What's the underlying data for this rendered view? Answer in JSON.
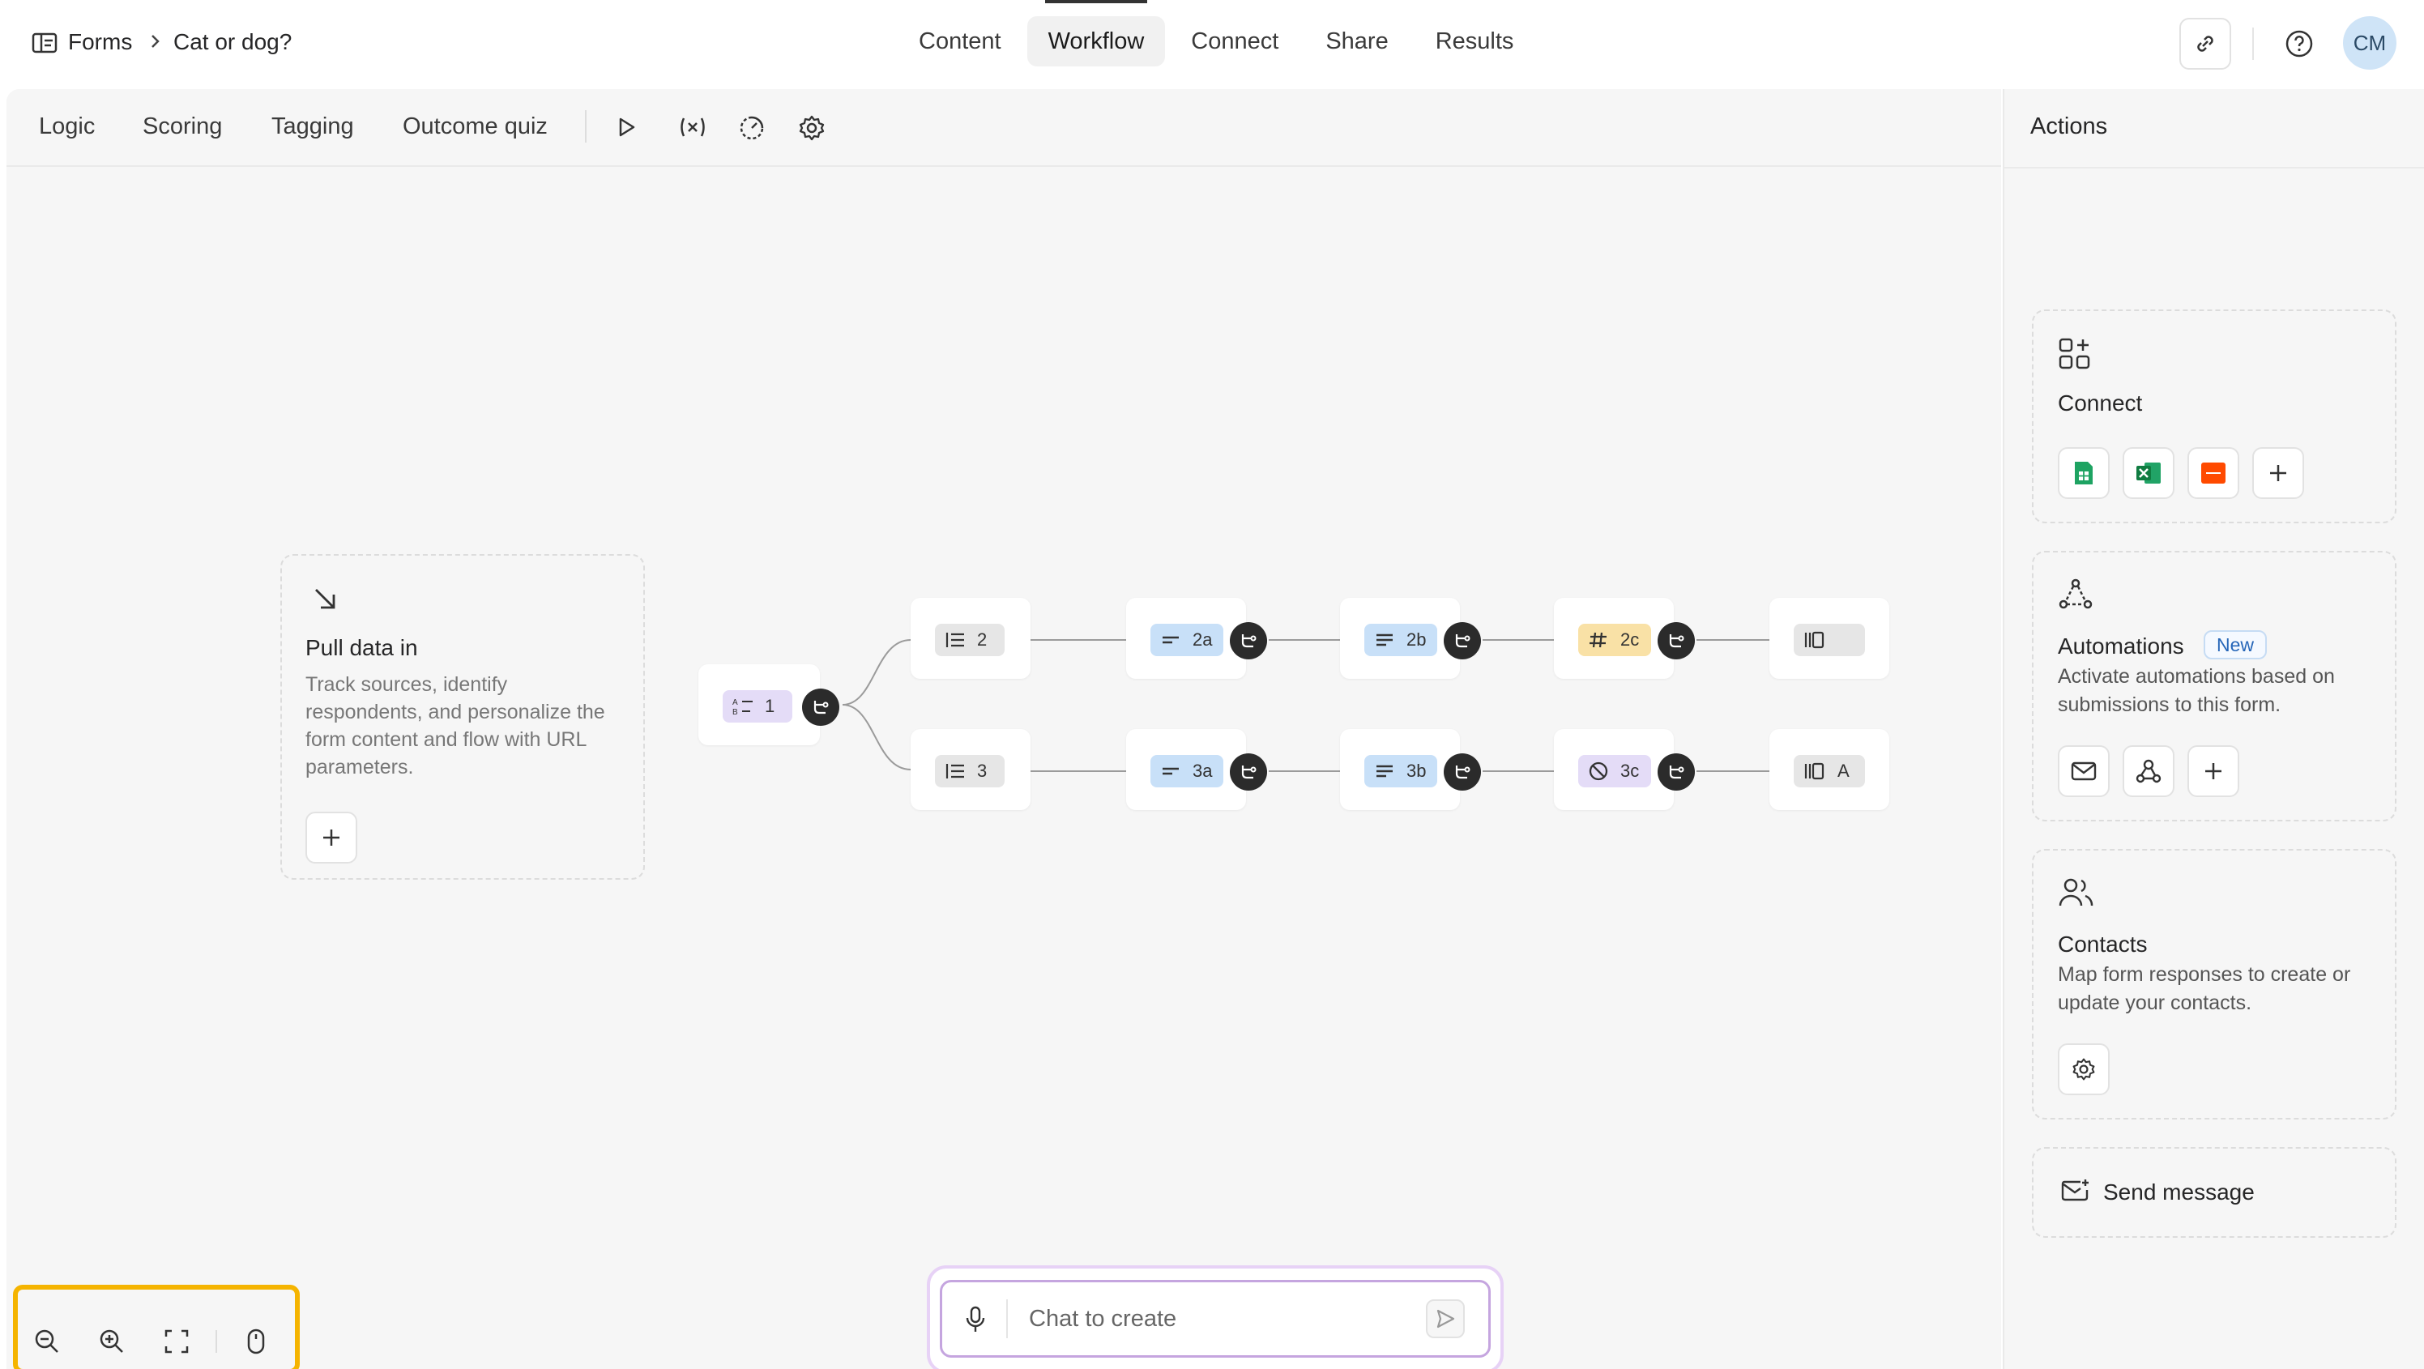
{
  "breadcrumb": {
    "root": "Forms",
    "current": "Cat or dog?"
  },
  "nav": {
    "tabs": [
      "Content",
      "Workflow",
      "Connect",
      "Share",
      "Results"
    ],
    "active": "Workflow"
  },
  "header": {
    "avatar_initials": "CM"
  },
  "toolbar": {
    "tabs": [
      "Logic",
      "Scoring",
      "Tagging",
      "Outcome quiz"
    ]
  },
  "pull_data": {
    "title": "Pull data in",
    "description": "Track sources, identify respondents, and personalize the form content and flow with URL parameters."
  },
  "flow": {
    "start": "1",
    "row1": [
      "2",
      "2a",
      "2b",
      "2c",
      ""
    ],
    "row2": [
      "3",
      "3a",
      "3b",
      "3c",
      "A"
    ]
  },
  "panel": {
    "title": "Actions",
    "connect": {
      "title": "Connect"
    },
    "automations": {
      "title": "Automations",
      "badge": "New",
      "description": "Activate automations based on submissions to this form."
    },
    "contacts": {
      "title": "Contacts",
      "description": "Map form responses to create or update your contacts."
    },
    "send_message": {
      "title": "Send message"
    }
  },
  "chat": {
    "placeholder": "Chat to create"
  },
  "colors": {
    "accent_highlight": "#f5b400",
    "avatar_bg": "#cfe4f7",
    "purple_chip": "#e4dcf7",
    "blue_chip": "#c8e0f8",
    "yellow_chip": "#f9e1a6"
  }
}
